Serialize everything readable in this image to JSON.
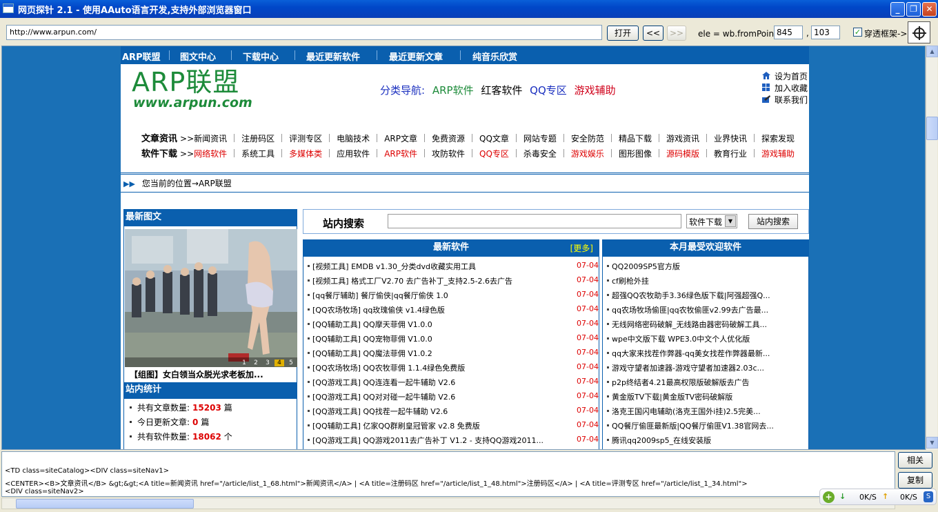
{
  "window": {
    "title": "网页探针 2.1  -  使用AAuto语言开发,支持外部浏览器窗口",
    "minimize": "_",
    "maximize": "❐",
    "close": "✕"
  },
  "toolbar": {
    "url": "http://www.arpun.com/",
    "open_label": "打开",
    "back_label": "<<",
    "forward_label": ">>",
    "frompoint_label": "ele = wb.fromPoint(",
    "x": "845",
    "comma": ",",
    "y": "103",
    "checkbox_checked": true,
    "checkbox_label": "穿透框架->"
  },
  "site": {
    "topnav": [
      "ARP联盟",
      "图文中心",
      "下载中心",
      "最近更新软件",
      "最近更新文章",
      "纯音乐欣赏"
    ],
    "logo_text": "ARP联盟",
    "logo_url": "www.arpun.com",
    "catnav": {
      "label": "分类导航:",
      "items": [
        {
          "text": "ARP软件",
          "color": "#1d8b3a"
        },
        {
          "text": "红客软件",
          "color": "#000000"
        },
        {
          "text": "QQ专区",
          "color": "#1a2fbf"
        },
        {
          "text": "游戏辅助",
          "color": "#d0021b"
        }
      ]
    },
    "quick_links": [
      "设为首页",
      "加入收藏",
      "联系我们"
    ],
    "menu": {
      "article_head": "文章资讯",
      "article_prefix": ">>",
      "article_items": [
        "新闻资讯",
        "注册码区",
        "评测专区",
        "电脑技术",
        "ARP文章",
        "免费资源",
        "QQ文章",
        "网站专题",
        "安全防范",
        "精品下载",
        "游戏资讯",
        "业界快讯",
        "探索发现"
      ],
      "software_head": "软件下载",
      "software_prefix": ">>",
      "software_items": [
        {
          "text": "网络软件",
          "red": true
        },
        {
          "text": "系统工具",
          "red": false
        },
        {
          "text": "多媒体类",
          "red": true
        },
        {
          "text": "应用软件",
          "red": false
        },
        {
          "text": "ARP软件",
          "red": true
        },
        {
          "text": "攻防软件",
          "red": false
        },
        {
          "text": "QQ专区",
          "red": true
        },
        {
          "text": "杀毒安全",
          "red": false
        },
        {
          "text": "游戏娱乐",
          "red": true
        },
        {
          "text": "图形图像",
          "red": false
        },
        {
          "text": "源码模版",
          "red": true
        },
        {
          "text": "教育行业",
          "red": false
        },
        {
          "text": "游戏辅助",
          "red": true
        }
      ]
    },
    "location_arrow": "▶▶",
    "location": "您当前的位置→ARP联盟",
    "latest_photo": {
      "head": "最新图文",
      "caption": "【组图】女白领当众脱光求老板加...",
      "pager": [
        "1",
        "2",
        "3",
        "4",
        "5"
      ]
    },
    "stats": {
      "head": "站内统计",
      "rows": [
        {
          "label": "共有文章数量:",
          "value": "15203",
          "unit": "篇"
        },
        {
          "label": "今日更新文章:",
          "value": "0",
          "unit": "篇"
        },
        {
          "label": "共有软件数量:",
          "value": "18062",
          "unit": "个"
        }
      ]
    },
    "search": {
      "label": "站内搜索",
      "select_value": "软件下载",
      "button": "站内搜索"
    },
    "latest_soft": {
      "head": "最新软件",
      "more": "[更多]",
      "items": [
        {
          "title": "[视频工具] EMDB v1.30_分类dvd收藏实用工具",
          "date": "07-04"
        },
        {
          "title": "[视频工具] 格式工厂V2.70 去广告补丁_支持2.5-2.6去广告",
          "date": "07-04"
        },
        {
          "title": "[qq餐厅辅助] 餐厅偷侠|qq餐厅偷侠 1.0",
          "date": "07-04"
        },
        {
          "title": "[QQ农场牧场] qq玫瑰偷侠 v1.4绿色版",
          "date": "07-04"
        },
        {
          "title": "[QQ辅助工具] QQ摩天菲佣 V1.0.0",
          "date": "07-04"
        },
        {
          "title": "[QQ辅助工具] QQ宠物菲佣 V1.0.0",
          "date": "07-04"
        },
        {
          "title": "[QQ辅助工具] QQ魔法菲佣 V1.0.2",
          "date": "07-04"
        },
        {
          "title": "[QQ农场牧场] QQ农牧菲佣 1.1.4绿色免费版",
          "date": "07-04"
        },
        {
          "title": "[QQ游戏工具] QQ连连看一起牛辅助 V2.6",
          "date": "07-04"
        },
        {
          "title": "[QQ游戏工具] QQ对对碰一起牛辅助 V2.6",
          "date": "07-04"
        },
        {
          "title": "[QQ游戏工具] QQ找茬一起牛辅助 V2.6",
          "date": "07-04"
        },
        {
          "title": "[QQ辅助工具] 亿家QQ群刷皇冠管家 v2.8 免费版",
          "date": "07-04"
        },
        {
          "title": "[QQ游戏工具] QQ游戏2011去广告补丁 V1.2 - 支持QQ游戏2011...",
          "date": "07-04"
        }
      ]
    },
    "popular_soft": {
      "head": "本月最受欢迎软件",
      "items": [
        "QQ2009SP5官方版",
        "cf刷枪外挂",
        "超强QQ农牧助手3.36绿色版下载|阿强超强Q...",
        "qq农场牧场偷匪|qq农牧偷匪v2.99去广告最...",
        "无线网络密码破解_无线路由器密码破解工具...",
        "wpe中文版下载 WPE3.0中文个人优化版",
        "qq大家来找茬作弊器-qq美女找茬作弊器最新...",
        "游戏守望者加速器-游戏守望者加速器2.03c...",
        "p2p终结者4.21最高权限版破解版去广告",
        "黄金版TV下载|黄金版TV密码破解版",
        "洛克王国闪电辅助(洛克王国外i挂)2.5完美...",
        "QQ餐厅偷匪最新版|QQ餐厅偷匪V1.38官网去...",
        "腾讯qq2009sp5_在线安装版"
      ]
    }
  },
  "html_panel": {
    "lines": [
      "<TD class=siteCatalog><DIV class=siteNav1>",
      "<CENTER><B>文章资讯</B> &gt;&gt;<A title=新闻资讯 href=\"/article/list_1_68.html\">新闻资讯</A> | <A title=注册码区 href=\"/article/list_1_48.html\">注册码区</A> | <A title=评测专区 href=\"/article/list_1_34.html\">",
      "<DIV class=siteNav2>"
    ],
    "related_button": "相关",
    "copy_button": "复制"
  },
  "netmeter": {
    "icon": "+",
    "down_arrow": "↓",
    "down_speed": "0K/S",
    "up_arrow": "↑",
    "up_speed": "0K/S",
    "badge": "S"
  }
}
